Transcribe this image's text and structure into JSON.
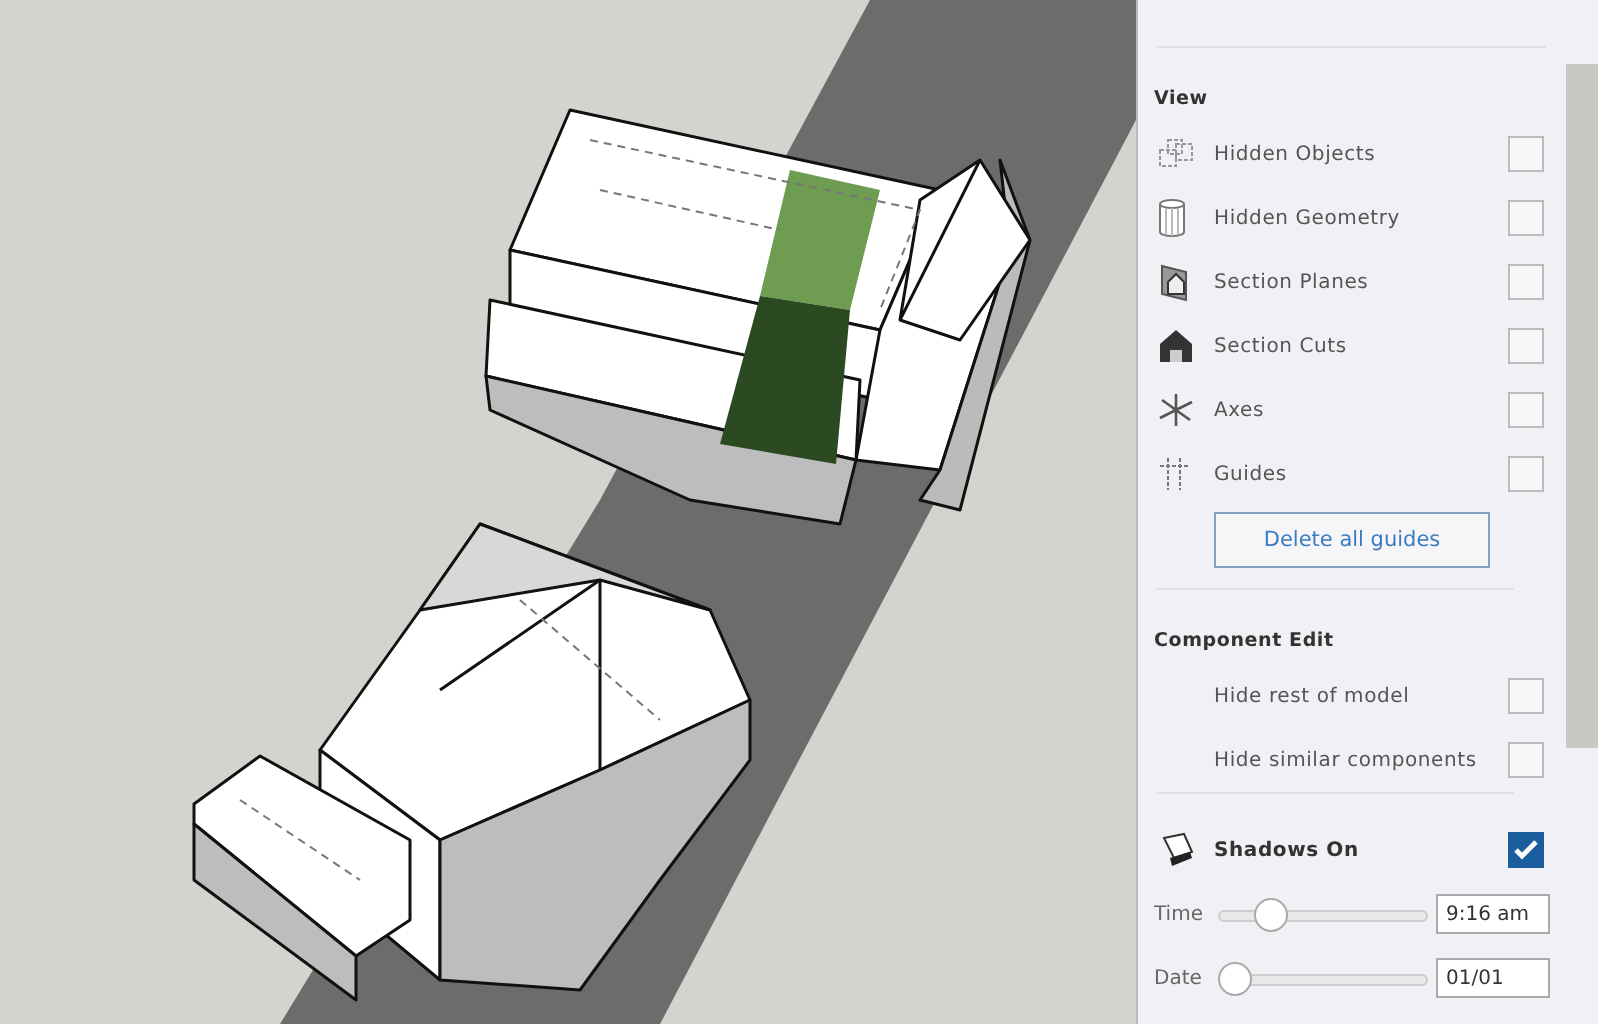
{
  "view": {
    "title": "View",
    "items": [
      {
        "label": "Hidden Objects",
        "kind": "objects",
        "checked": false
      },
      {
        "label": "Hidden Geometry",
        "kind": "geometry",
        "checked": false
      },
      {
        "label": "Section Planes",
        "kind": "planes",
        "checked": false
      },
      {
        "label": "Section Cuts",
        "kind": "cuts",
        "checked": false
      },
      {
        "label": "Axes",
        "kind": "axes",
        "checked": false
      },
      {
        "label": "Guides",
        "kind": "guides",
        "checked": false
      }
    ],
    "button": "Delete all guides"
  },
  "component_edit": {
    "title": "Component Edit",
    "items": [
      {
        "label": "Hide rest of model",
        "checked": false
      },
      {
        "label": "Hide similar components",
        "checked": false
      }
    ]
  },
  "shadows": {
    "label": "Shadows On",
    "checked": true,
    "sliders": [
      {
        "label": "Time",
        "level": 0.2,
        "value": "9:16 am"
      },
      {
        "label": "Date",
        "level": 0.0,
        "value": "01/01"
      }
    ]
  }
}
